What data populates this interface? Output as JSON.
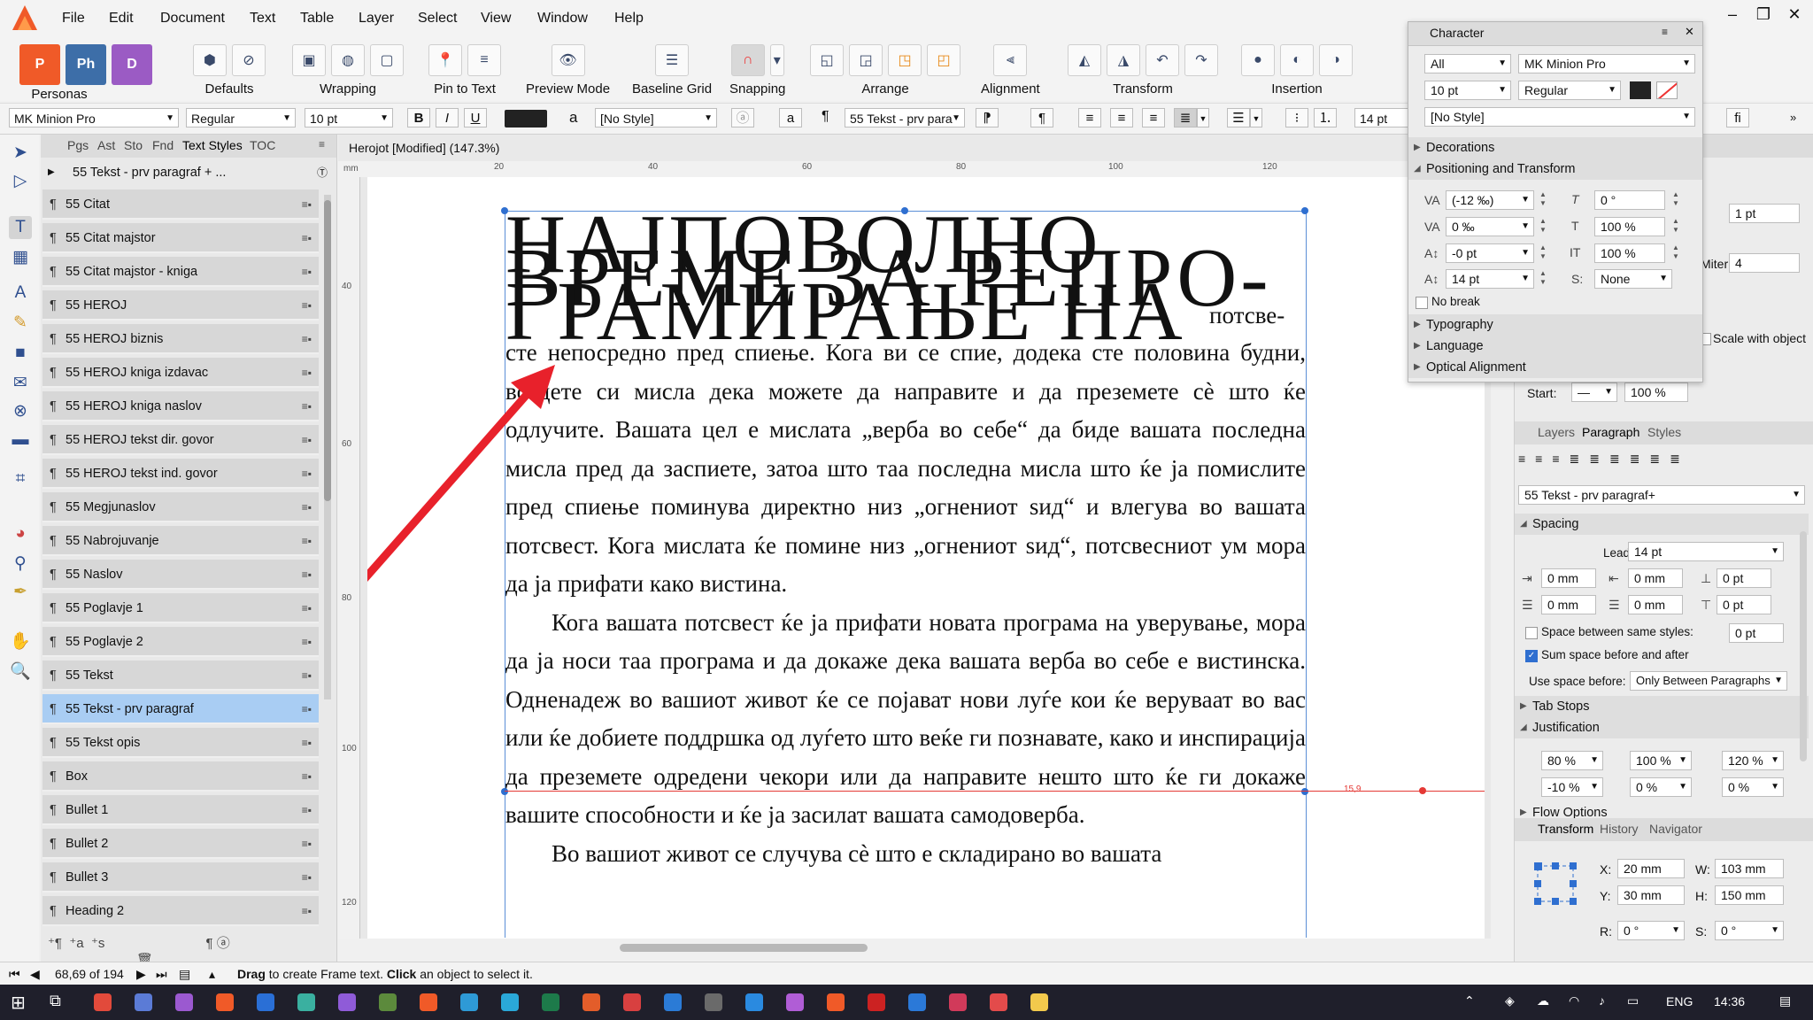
{
  "menu": [
    "File",
    "Edit",
    "Document",
    "Text",
    "Table",
    "Layer",
    "Select",
    "View",
    "Window",
    "Help"
  ],
  "toolbar": {
    "personas": "Personas",
    "defaults": "Defaults",
    "wrapping": "Wrapping",
    "pin_to_text": "Pin to Text",
    "preview_mode": "Preview Mode",
    "baseline_grid": "Baseline Grid",
    "snapping": "Snapping",
    "arrange": "Arrange",
    "alignment": "Alignment",
    "transform": "Transform",
    "insertion": "Insertion"
  },
  "context": {
    "font": "MK Minion Pro",
    "weight": "Regular",
    "size": "10 pt",
    "bold": "B",
    "italic": "I",
    "underline": "U",
    "char_style": "[No Style]",
    "para_style": "55 Tekst - prv para",
    "leading": "14 pt",
    "fi": "fi"
  },
  "styles_panel": {
    "tabs": [
      "Pgs",
      "Ast",
      "Sto",
      "Fnd",
      "Text Styles",
      "TOC"
    ],
    "current": "55 Tekst - prv paragraf + ...",
    "items": [
      "55 Citat",
      "55 Citat majstor",
      "55 Citat majstor - kniga",
      "55 HEROJ",
      "55 HEROJ biznis",
      "55 HEROJ kniga izdavac",
      "55 HEROJ kniga naslov",
      "55 HEROJ tekst dir. govor",
      "55 HEROJ tekst ind. govor",
      "55 Megjunaslov",
      "55 Nabrojuvanje",
      "55 Naslov",
      "55 Poglavje 1",
      "55 Poglavje 2",
      "55 Tekst",
      "55 Tekst - prv paragraf",
      "55 Tekst opis",
      "Box",
      "Bullet 1",
      "Bullet 2",
      "Bullet 3",
      "Heading 2"
    ],
    "selected_index": 15
  },
  "document": {
    "title": "Herojot [Modified] (147.3%)",
    "ruler_unit": "mm",
    "ruler_top": [
      "20",
      "40",
      "60",
      "80",
      "100",
      "120"
    ],
    "ruler_left": [
      "40",
      "60",
      "80",
      "100",
      "120"
    ],
    "heading_lines": [
      "НАЈПОВОЛНО",
      "ВРЕМЕ ЗА РЕПРО-",
      "ГРАМИРАЊЕ НА"
    ],
    "heading_tail": "потсве-",
    "paragraphs": [
      "сте непосредно пред спиење. Кога ви се спие, додека сте половина будни, всадете си мисла дека можете да направите и да преземете сѐ што ќе одлучите. Вашата цел е мислата „верба во себе“ да биде вашата последна мисла пред да заспиете, затоа што таа последна мисла што ќе ја помислите пред спиење поминува директно низ „огнениот ѕид“ и влегува во вашата потсвест. Кога мислата ќе помине низ „огнениот ѕид“, потсвесниот ум мора да ја прифати како вистина.",
      "Кога вашата потсвест ќе ја прифати новата програма на уверување, мора да ја носи таа програма и да докаже дека вашата верба во себе е вистинска. Одненадеж во вашиот живот ќе се појават нови луѓе кои ќе веруваат во вас или ќе добиете поддршка од луѓето што веќе ги познавате, како и инспирација да преземете одредени чекори или да направите нешто што ќе ги докаже вашите способности и ќе ја засилат вашата самодоверба.",
      "Во вашиот живот се случува сѐ што е складирано во вашата"
    ],
    "guide_label": "15,9"
  },
  "character_panel": {
    "title": "Character",
    "scope": "All",
    "font": "MK Minion Pro",
    "size": "10 pt",
    "weight": "Regular",
    "style": "[No Style]",
    "sections": [
      "Decorations",
      "Positioning and Transform",
      "Typography",
      "Language",
      "Optical Alignment"
    ],
    "kerning": "(-12 ‰)",
    "skew": "0 °",
    "tracking": "0 ‰",
    "vscale": "100 %",
    "baseline": "-0 pt",
    "hscale": "100 %",
    "leading": "14 pt",
    "position": "None",
    "no_break": "No break"
  },
  "right_panel": {
    "stroke_width": "1 pt",
    "miter_label": "Miter:",
    "miter": "4",
    "scale_with_object": "Scale with object",
    "start_label": "Start:",
    "start_pct": "100 %",
    "tabs": [
      "Layers",
      "Paragraph",
      "Styles"
    ],
    "para_style": "55 Tekst - prv paragraf+",
    "spacing": "Spacing",
    "leading_label": "Leading:",
    "leading": "14 pt",
    "indent_fields": [
      "0 mm",
      "0 mm",
      "0 pt",
      "0 mm",
      "0 mm",
      "0 pt"
    ],
    "space_same_label": "Space between same styles:",
    "space_same": "0 pt",
    "sum_space": "Sum space before and after",
    "use_space_label": "Use space before:",
    "use_space": "Only Between Paragraphs",
    "tab_stops": "Tab Stops",
    "justification": "Justification",
    "just_fields": [
      "80 %",
      "100 %",
      "120 %",
      "-10 %",
      "0 %",
      "0 %"
    ],
    "flow_options": "Flow Options",
    "transform_tabs": [
      "Transform",
      "History",
      "Navigator"
    ],
    "x_label": "X:",
    "x": "20 mm",
    "y_label": "Y:",
    "y": "30 mm",
    "w_label": "W:",
    "w": "103 mm",
    "h_label": "H:",
    "h": "150 mm",
    "r_label": "R:",
    "r": "0 °",
    "s_label": "S:",
    "s": "0 °"
  },
  "status": {
    "pages": "68,69 of 194",
    "hint_bold1": "Drag",
    "hint1": " to create Frame text. ",
    "hint_bold2": "Click",
    "hint2": " an object to select it."
  },
  "taskbar": {
    "lang": "ENG",
    "time": "14:36"
  },
  "colors": {
    "accent": "#2f6fd0",
    "selection": "#a9cdf3",
    "arrow": "#e8212b",
    "affinity": "#f05a28"
  }
}
